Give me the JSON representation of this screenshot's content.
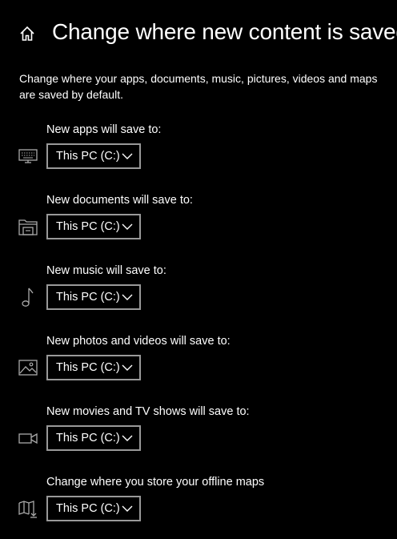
{
  "header": {
    "title": "Change where new content is saved",
    "home_icon": "home-icon"
  },
  "description": "Change where your apps, documents, music, pictures, videos and maps are saved by default.",
  "settings": [
    {
      "label": "New apps will save to:",
      "value": "This PC (C:)",
      "icon": "monitor-icon"
    },
    {
      "label": "New documents will save to:",
      "value": "This PC (C:)",
      "icon": "documents-icon"
    },
    {
      "label": "New music will save to:",
      "value": "This PC (C:)",
      "icon": "music-note-icon"
    },
    {
      "label": "New photos and videos will save to:",
      "value": "This PC (C:)",
      "icon": "photo-icon"
    },
    {
      "label": "New movies and TV shows will save to:",
      "value": "This PC (C:)",
      "icon": "video-camera-icon"
    },
    {
      "label": "Change where you store your offline maps",
      "value": "This PC (C:)",
      "icon": "map-download-icon"
    }
  ],
  "colors": {
    "background": "#000000",
    "text": "#ffffff",
    "border": "#999999",
    "icon": "#aaaaaa"
  }
}
